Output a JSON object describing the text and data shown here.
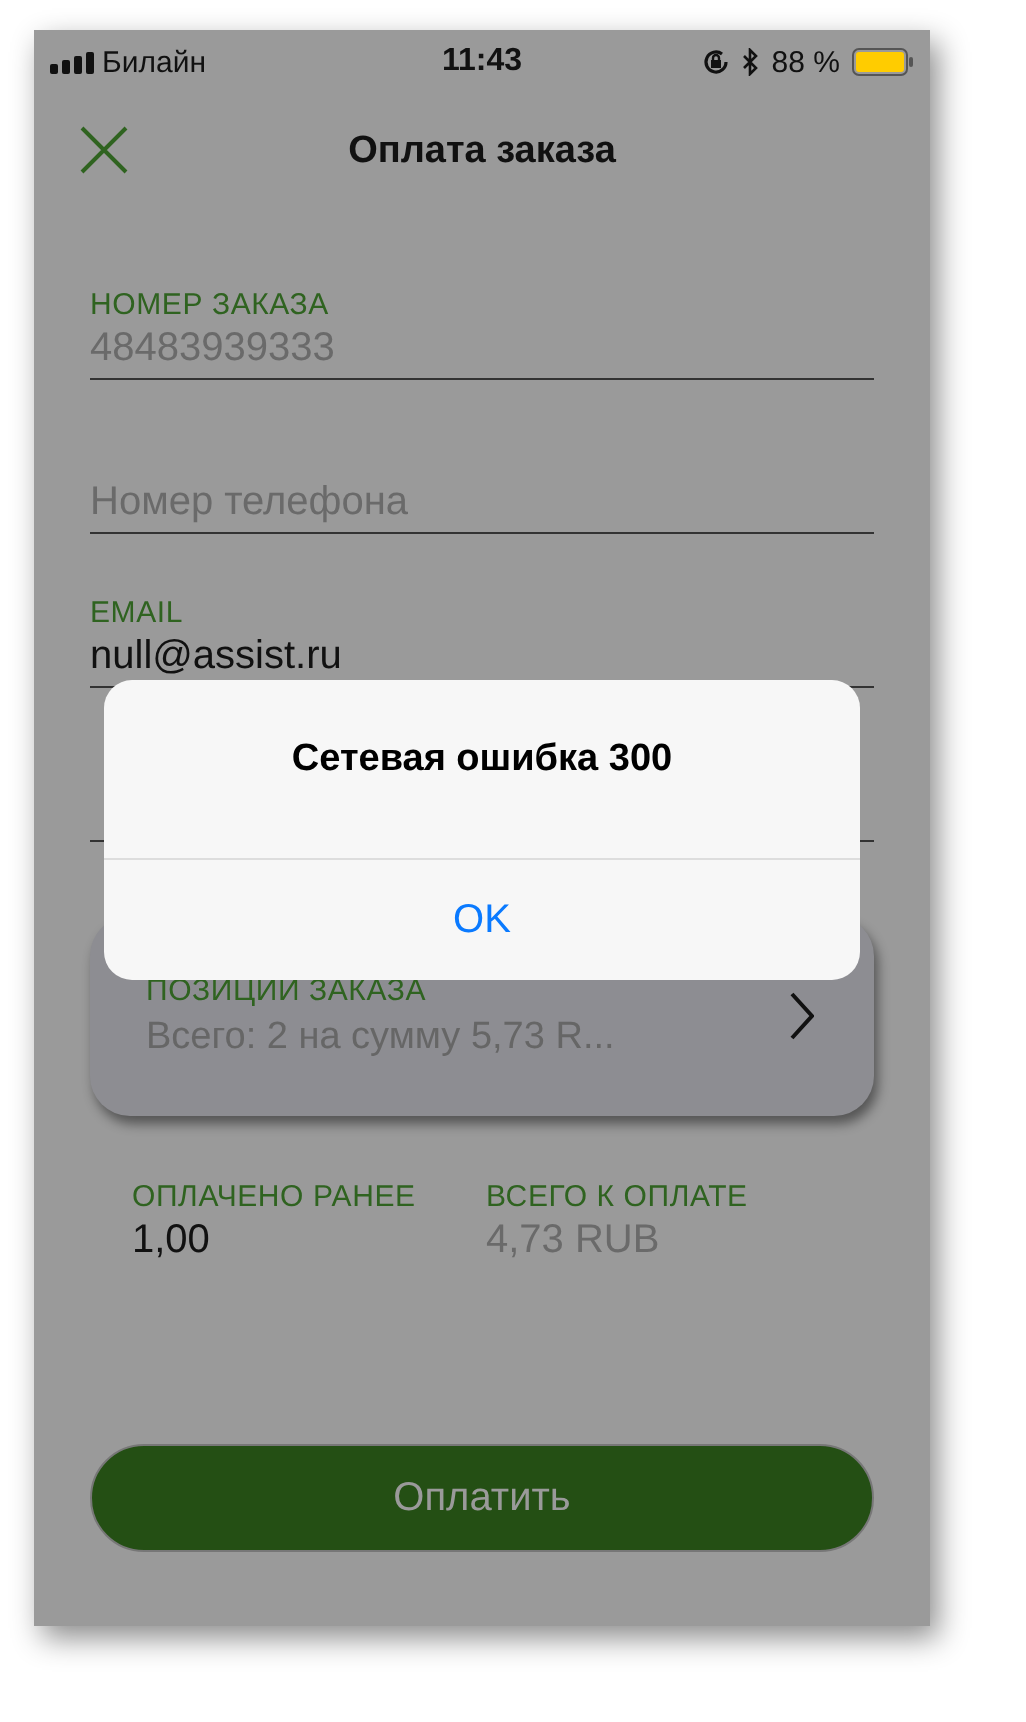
{
  "status_bar": {
    "carrier": "Билайн",
    "time": "11:43",
    "battery": "88 %"
  },
  "nav": {
    "title": "Оплата заказа"
  },
  "fields": [
    {
      "label": "НОМЕР ЗАКАЗА",
      "value": "48483939333",
      "disabled": true
    },
    {
      "placeholder": "Номер телефона"
    },
    {
      "label": "EMAIL",
      "value": "null@assist.ru",
      "disabled": false
    }
  ],
  "order_items": {
    "title": "ПОЗИЦИИ ЗАКАЗА",
    "summary": "Всего: 2 на сумму 5,73 R..."
  },
  "totals": [
    {
      "label": "ОПЛАЧЕНО РАНЕЕ",
      "value": "1,00",
      "disabled": false
    },
    {
      "label": "ВСЕГО К ОПЛАТЕ",
      "value": "4,73 RUB",
      "disabled": true
    }
  ],
  "pay_button": {
    "label": "Оплатить",
    "disabled": true
  },
  "alert": {
    "title": "Сетевая ошибка 300",
    "buttons": [
      "OK"
    ]
  }
}
